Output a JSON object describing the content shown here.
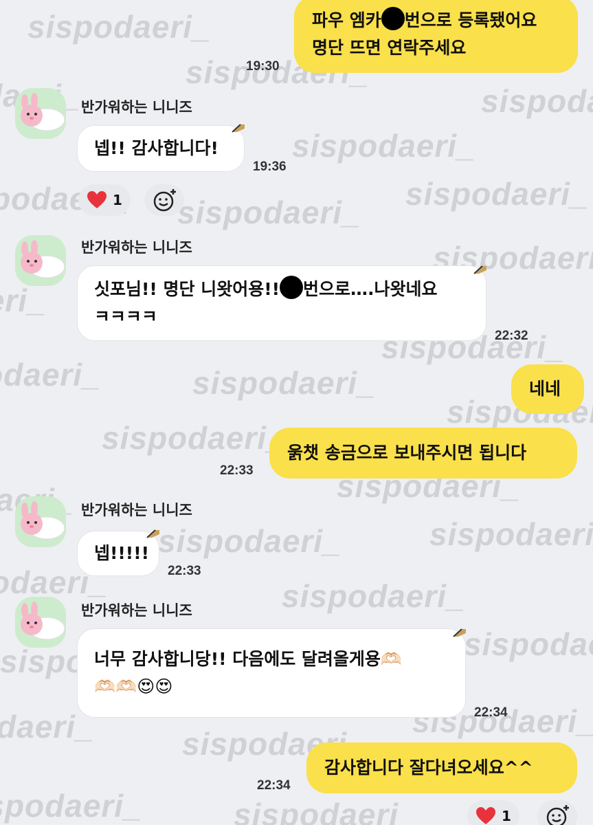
{
  "watermark": "sispodaeri_",
  "sender_name": "반가워하는 니니즈",
  "messages": [
    {
      "side": "me",
      "lines": [
        "파우 엠카",
        "번으로 등록됐어요",
        "명단 뜨면 연락주세요"
      ],
      "time": "19:30"
    },
    {
      "side": "them",
      "lines": [
        "넵!! 감사합니다!"
      ],
      "time": "19:36"
    },
    {
      "side": "them",
      "lines": [
        "싯포님!! 명단 니왓어용!!",
        "번으로….나왓네요",
        "ㅋㅋㅋㅋ"
      ],
      "time": "22:32"
    },
    {
      "side": "me",
      "lines": [
        "네네"
      ]
    },
    {
      "side": "me",
      "lines": [
        "욹챗 송금으로 보내주시면 됩니다"
      ],
      "time": "22:33"
    },
    {
      "side": "them",
      "lines": [
        "넵!!!!!"
      ],
      "time": "22:33"
    },
    {
      "side": "them",
      "lines": [
        "너무 감사합니당!! 다음에도 달려올게용🫶🏻",
        "🫶🏻🫶🏻😍😍"
      ],
      "time": "22:34"
    },
    {
      "side": "me",
      "lines": [
        "감사합니다 잘다녀오세요^^"
      ],
      "time": "22:34"
    }
  ],
  "reactions": [
    {
      "icon": "heart-icon",
      "count": "1"
    },
    {
      "icon": "heart-icon",
      "count": "1"
    }
  ],
  "colors": {
    "my_bubble": "#fae04a",
    "their_bubble": "#ffffff",
    "background": "#eeeff2",
    "heart": "#e8323c"
  }
}
